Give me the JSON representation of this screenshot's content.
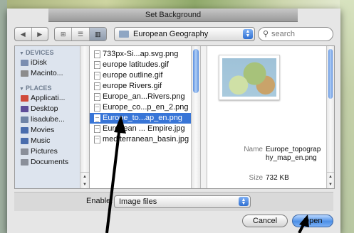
{
  "dialog": {
    "title": "Set Background"
  },
  "toolbar": {
    "back_icon": "back-arrow-icon",
    "forward_icon": "forward-arrow-icon",
    "view_modes": [
      "icon-view",
      "list-view",
      "column-view"
    ],
    "active_view": "column-view",
    "location": "European Geography",
    "search_placeholder": "search"
  },
  "sidebar": {
    "devices_header": "DEVICES",
    "devices": [
      {
        "label": "iDisk",
        "icon": "idisk-icon",
        "color": "#7a8db0"
      },
      {
        "label": "Macinto...",
        "icon": "hard-drive-icon",
        "color": "#8c8c8c"
      }
    ],
    "places_header": "PLACES",
    "places": [
      {
        "label": "Applicati...",
        "icon": "applications-icon",
        "color": "#d04a3b"
      },
      {
        "label": "Desktop",
        "icon": "desktop-icon",
        "color": "#5e4d99"
      },
      {
        "label": "lisadube...",
        "icon": "home-icon",
        "color": "#6f84a6"
      },
      {
        "label": "Movies",
        "icon": "movies-icon",
        "color": "#4a6dad"
      },
      {
        "label": "Music",
        "icon": "music-icon",
        "color": "#4a6dad"
      },
      {
        "label": "Pictures",
        "icon": "pictures-icon",
        "color": "#8a8f99"
      },
      {
        "label": "Documents",
        "icon": "documents-icon",
        "color": "#8a8f99"
      }
    ]
  },
  "files": [
    {
      "name": "733px-Si...ap.svg.png",
      "selected": false
    },
    {
      "name": "europe latitudes.gif",
      "selected": false
    },
    {
      "name": "europe outline.gif",
      "selected": false
    },
    {
      "name": "europe Rivers.gif",
      "selected": false
    },
    {
      "name": "Europe_an...Rivers.png",
      "selected": false
    },
    {
      "name": "Europe_co...p_en_2.png",
      "selected": false
    },
    {
      "name": "Europe_to...ap_en.png",
      "selected": true
    },
    {
      "name": "European ... Empire.jpg",
      "selected": false
    },
    {
      "name": "mediterranean_basin.jpg",
      "selected": false
    }
  ],
  "preview": {
    "name_label": "Name",
    "name_value": "Europe_topography_map_en.png",
    "size_label": "Size",
    "size_value": "732 KB"
  },
  "footer": {
    "enable_label": "Enable:",
    "enable_value": "Image files",
    "cancel_label": "Cancel",
    "open_label": "Open",
    "accent_color": "#3875d7"
  }
}
